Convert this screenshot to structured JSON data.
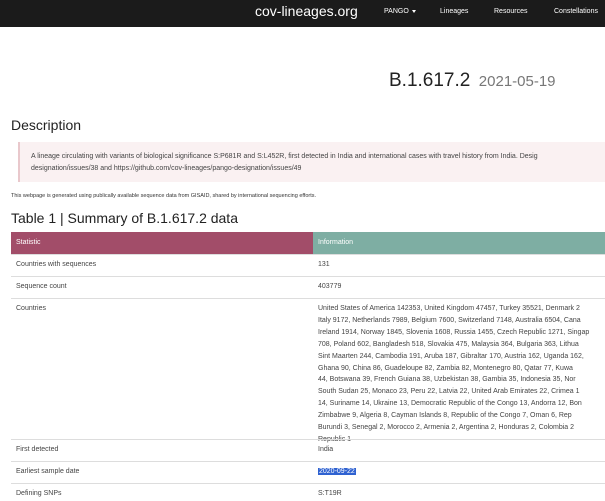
{
  "navbar": {
    "brand": "cov-lineages.org",
    "items": [
      "PANGO",
      "Lineages",
      "Resources",
      "Constellations"
    ]
  },
  "lineage": {
    "name": "B.1.617.2",
    "date": "2021-05-19"
  },
  "description": {
    "heading": "Description",
    "lines": [
      "A lineage circulating with variants of biological significance S:P681R and S:L452R, first detected in India and international cases with travel history from India. Desig",
      "designation/issues/38 and https://github.com/cov-lineages/pango-designation/issues/49"
    ]
  },
  "note": "This webpage is generated using publically available sequence data from GISAID, shared by international sequencing efforts.",
  "table": {
    "title": "Table 1 | Summary of B.1.617.2 data",
    "headers": {
      "statistic": "Statistic",
      "information": "Information"
    },
    "rows": {
      "countries_with_sequences": {
        "label": "Countries with sequences",
        "value": "131"
      },
      "sequence_count": {
        "label": "Sequence count",
        "value": "403779"
      },
      "countries": {
        "label": "Countries",
        "lines": [
          "United States of America 142353, United Kingdom 47457, Turkey 35521, Denmark 2",
          "Italy 9172, Netherlands 7989, Belgium 7600, Switzerland 7148, Australia 6504, Cana",
          "Ireland 1914, Norway 1845, Slovenia 1608, Russia 1455, Czech Republic 1271, Singap",
          "708, Poland 602, Bangladesh 518, Slovakia 475, Malaysia 364, Bulgaria 363, Lithua",
          "Sint Maarten 244, Cambodia 191, Aruba 187, Gibraltar 170, Austria 162, Uganda 162,",
          "Ghana 90, China 86, Guadeloupe 82, Zambia 82, Montenegro 80, Qatar 77, Kuwa",
          "44, Botswana 39, French Guiana 38, Uzbekistan 38, Gambia 35, Indonesia 35, Nor",
          "South Sudan 25, Monaco 23, Peru 22, Latvia 22, United Arab Emirates 22, Crimea 1",
          "14, Suriname 14, Ukraine 13, Democratic Republic of the Congo 13, Andorra 12, Bon",
          "Zimbabwe 9, Algeria 8, Cayman Islands 8, Republic of the Congo 7, Oman 6, Rep",
          "Burundi 3, Senegal 2, Morocco 2, Armenia 2, Argentina 2, Honduras 2, Colombia 2",
          "Republic 1"
        ]
      },
      "first_detected": {
        "label": "First detected",
        "value": "India"
      },
      "earliest_sample_date": {
        "label": "Earliest sample date",
        "value": "2020-09-22"
      },
      "defining_snps": {
        "label": "Defining SNPs",
        "value": "S:T19R"
      }
    }
  },
  "colors": {
    "navbar": "#1b1b1b",
    "statistic_header": "#a24d69",
    "information_header": "#7eaea3",
    "selection": "#2f62d1"
  }
}
